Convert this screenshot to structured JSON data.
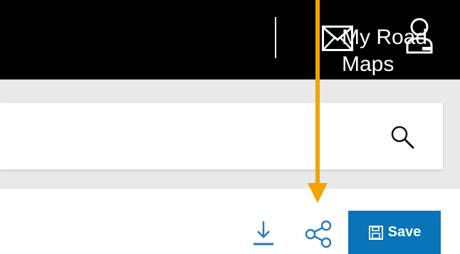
{
  "header": {
    "nav_link": "My Road Maps",
    "icons": [
      "mail-icon",
      "user-icon"
    ]
  },
  "search": {
    "value": "",
    "placeholder": "",
    "icon": "search-icon"
  },
  "toolbar": {
    "download_icon": "download-icon",
    "share_icon": "share-icon",
    "save_label": "Save",
    "save_icon": "floppy-disk-icon"
  },
  "colors": {
    "header_bg": "#000000",
    "search_band_bg": "#e9e9e9",
    "accent_blue": "#0a74b8",
    "annotation_orange": "#f2a300"
  }
}
